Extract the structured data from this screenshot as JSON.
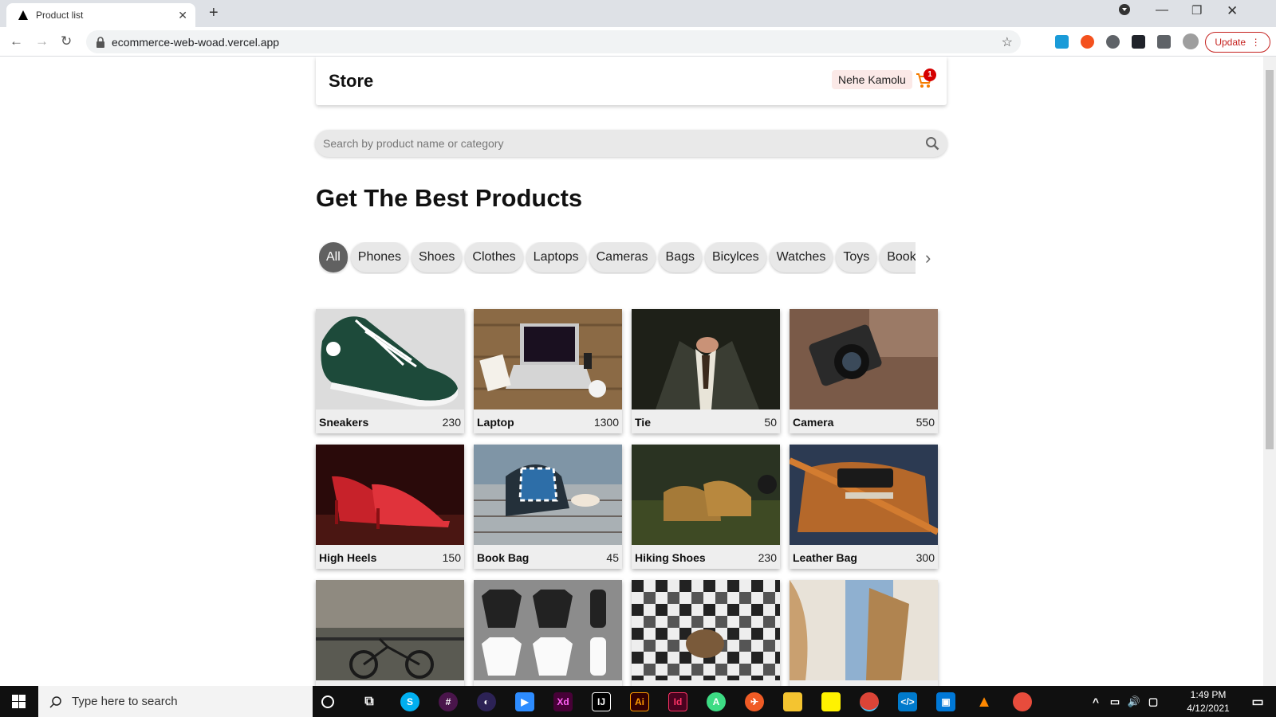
{
  "browser": {
    "tab_title": "Product list",
    "url": "ecommerce-web-woad.vercel.app",
    "update_label": "Update"
  },
  "header": {
    "logo": "Store",
    "user_name": "Nehe Kamolu",
    "cart_count": "1"
  },
  "search": {
    "placeholder": "Search by product name or category"
  },
  "heading": "Get The Best Products",
  "categories": [
    "All",
    "Phones",
    "Shoes",
    "Clothes",
    "Laptops",
    "Cameras",
    "Bags",
    "Bicylces",
    "Watches",
    "Toys",
    "Books"
  ],
  "products": [
    {
      "name": "Sneakers",
      "price": "230"
    },
    {
      "name": "Laptop",
      "price": "1300"
    },
    {
      "name": "Tie",
      "price": "50"
    },
    {
      "name": "Camera",
      "price": "550"
    },
    {
      "name": "High Heels",
      "price": "150"
    },
    {
      "name": "Book Bag",
      "price": "45"
    },
    {
      "name": "Hiking Shoes",
      "price": "230"
    },
    {
      "name": "Leather Bag",
      "price": "300"
    }
  ],
  "taskbar": {
    "search_placeholder": "Type here to search",
    "time": "1:49 PM",
    "date": "4/12/2021"
  }
}
